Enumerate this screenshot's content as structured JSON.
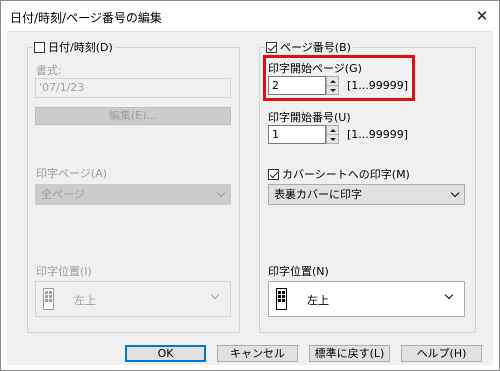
{
  "window": {
    "title": "日付/時刻/ページ番号の編集",
    "close_glyph": "✕"
  },
  "date_group": {
    "checkbox_label": "日付/時刻(D)",
    "checked": false,
    "format_label": "書式:",
    "format_value": "'07/1/23",
    "edit_button": "編集(E)...",
    "print_pages_label": "印字ページ(A)",
    "print_pages_value": "全ページ",
    "position_label": "印字位置(I)",
    "position_value": "左上"
  },
  "page_group": {
    "checkbox_label": "ページ番号(B)",
    "checked": true,
    "start_page_label": "印字開始ページ(G)",
    "start_page_value": "2",
    "start_page_range": "[1...99999]",
    "start_number_label": "印字開始番号(U)",
    "start_number_value": "1",
    "start_number_range": "[1...99999]",
    "cover_checkbox_label": "カバーシートへの印字(M)",
    "cover_checked": true,
    "cover_value": "表裏カバーに印字",
    "position_label": "印字位置(N)",
    "position_value": "左上"
  },
  "buttons": {
    "ok": "OK",
    "cancel": "キャンセル",
    "restore": "標準に戻す(L)",
    "help": "ヘルプ(H)"
  },
  "colors": {
    "highlight": "#e01010",
    "focus_border": "#0078d7",
    "disabled_text": "#9d9d9d"
  }
}
